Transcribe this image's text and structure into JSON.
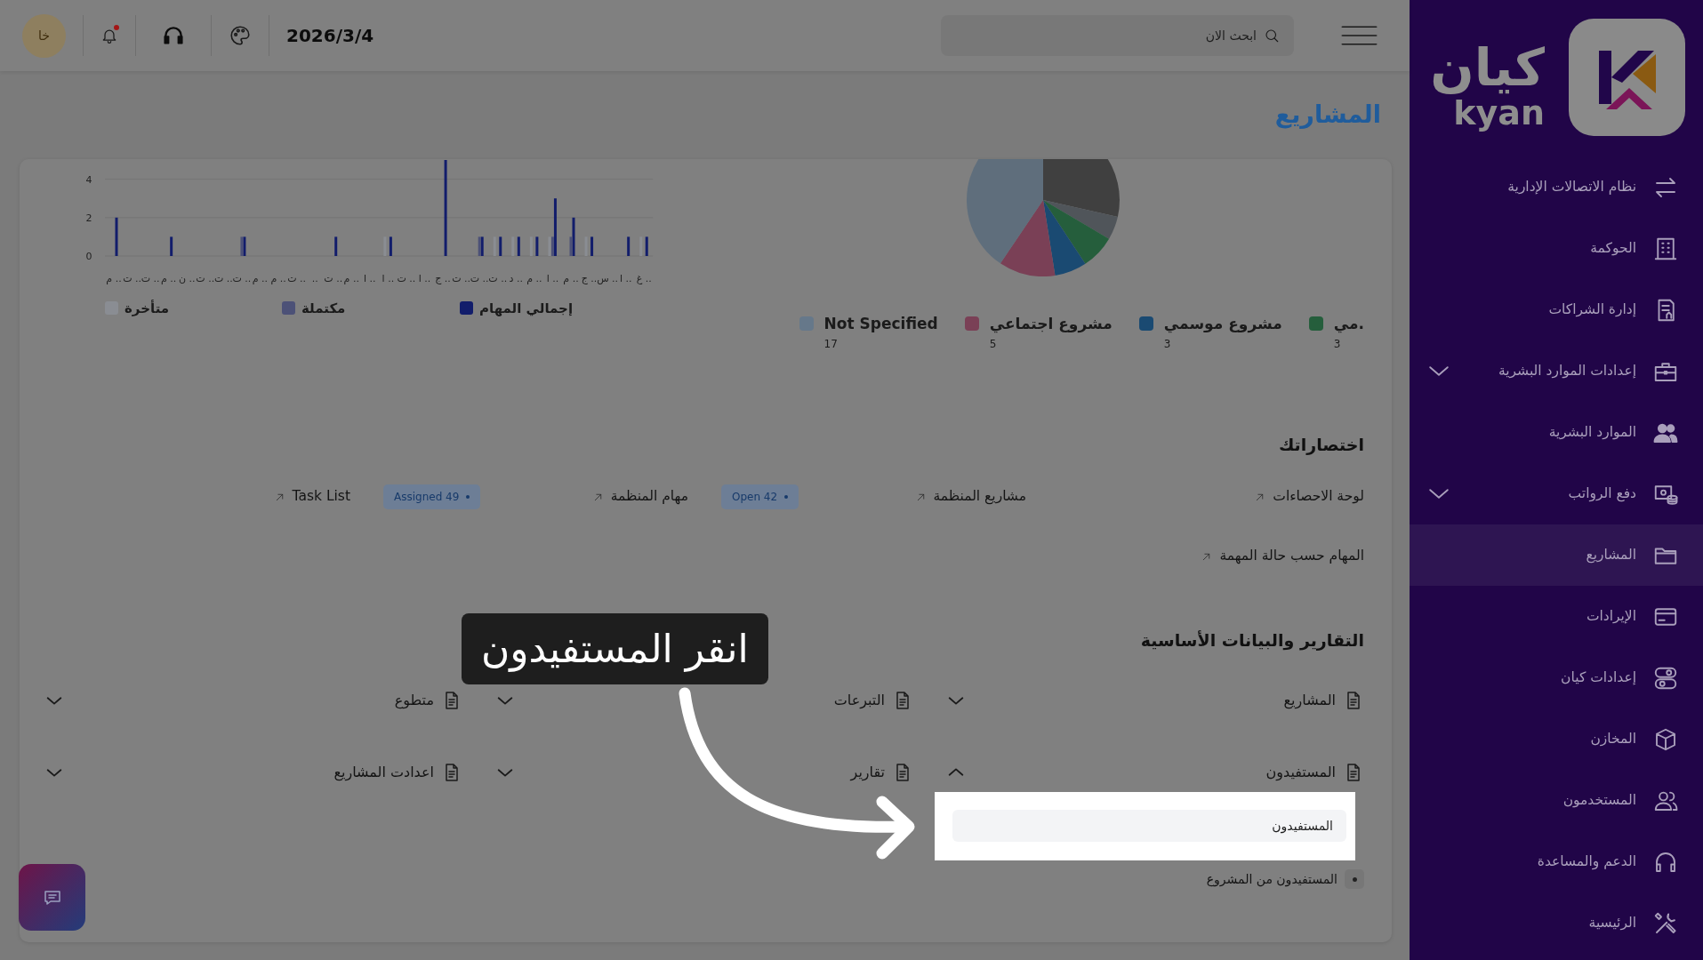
{
  "sidebar": {
    "logo": {
      "arabic": "كيان",
      "latin": "kyan"
    },
    "items": [
      {
        "label": "نظام الاتصالات الإدارية",
        "has_submenu": false,
        "selected": false
      },
      {
        "label": "الحوكمة",
        "has_submenu": false,
        "selected": false
      },
      {
        "label": "إدارة الشراكات",
        "has_submenu": false,
        "selected": false
      },
      {
        "label": "إعدادات الموارد البشرية",
        "has_submenu": true,
        "selected": false
      },
      {
        "label": "الموارد البشرية",
        "has_submenu": false,
        "selected": false
      },
      {
        "label": "دفع الرواتب",
        "has_submenu": true,
        "selected": false
      },
      {
        "label": "المشاريع",
        "has_submenu": false,
        "selected": true
      },
      {
        "label": "الإيرادات",
        "has_submenu": false,
        "selected": false
      },
      {
        "label": "إعدادات كيان",
        "has_submenu": false,
        "selected": false
      },
      {
        "label": "المخازن",
        "has_submenu": false,
        "selected": false
      },
      {
        "label": "المستخدمون",
        "has_submenu": false,
        "selected": false
      },
      {
        "label": "الدعم والمساعدة",
        "has_submenu": false,
        "selected": false
      },
      {
        "label": "الرئيسية",
        "has_submenu": false,
        "selected": false
      }
    ]
  },
  "topbar": {
    "search": {
      "placeholder": "ابحث الان"
    },
    "date": "2026/3/4",
    "unread": true,
    "avatar": "خا"
  },
  "page_title": "المشاريع",
  "pie_legend": [
    {
      "label": "مي.",
      "count": "3",
      "color": "#255e3c"
    },
    {
      "label": "مشروع موسمي",
      "count": "3",
      "color": "#1a4a72"
    },
    {
      "label": "مشروع اجتماعي",
      "count": "5",
      "color": "#7a4056"
    },
    {
      "label": "Not Specified",
      "count": "17",
      "color": "#66788a"
    }
  ],
  "bar_chart": {
    "chart_data": {
      "type": "bar",
      "categories": [
        "م ..",
        "ت ..",
        "ت ..",
        "م ..",
        "ن ..",
        "ت ..",
        "ت ..",
        "ت ..",
        "م ..",
        "م ..",
        "ت ..",
        "..",
        "ت ..",
        "م ..",
        "ا ..",
        "ا ..",
        "ت ..",
        "ا ..",
        "ج ..",
        "ت ..",
        "ت ..",
        "ت ..",
        "د ..",
        "م ..",
        "ا ..",
        "م ..",
        "ج ..",
        "س ..",
        "ا ..",
        "غ .."
      ],
      "yticks": [
        0,
        2,
        4
      ],
      "ylim": [
        0,
        5
      ],
      "legend": "bottom",
      "series": [
        {
          "name": "إجمالي المهام",
          "color": "#121d6b",
          "values": [
            2,
            0,
            0,
            1,
            0,
            0,
            0,
            1,
            0,
            0,
            0,
            0,
            1,
            0,
            0,
            1,
            0,
            0,
            5,
            0,
            1,
            1,
            1,
            1,
            3,
            2,
            1,
            0,
            1,
            1
          ]
        },
        {
          "name": "مكتملة",
          "color": "#4c5177",
          "values": [
            0,
            0,
            0,
            0,
            0,
            0,
            0,
            1,
            0,
            0,
            0,
            0,
            0,
            0,
            0,
            0,
            0,
            0,
            0,
            0,
            1,
            0,
            0,
            0,
            1,
            1,
            0,
            0,
            0,
            0
          ]
        },
        {
          "name": "متأخرة",
          "color": "#8a8d93",
          "values": [
            0,
            0,
            0,
            0,
            0,
            0,
            0,
            0,
            0,
            0,
            0,
            0,
            0,
            0,
            0,
            1,
            0,
            0,
            0,
            0,
            0,
            1,
            1,
            1,
            1,
            0,
            1,
            0,
            0,
            1
          ]
        }
      ]
    }
  },
  "shortcuts": {
    "title": "اختصاراتك",
    "items": [
      {
        "label": "لوحة الاحصاءات"
      },
      {
        "label": "مشاريع المنظمة",
        "badge": "Open 42"
      },
      {
        "label": "مهام المنظمة",
        "badge": "Assigned 49"
      },
      {
        "label": "Task List"
      },
      {
        "label": "المهام حسب حالة المهمة"
      }
    ]
  },
  "reports": {
    "title": "التقارير والبيانات الأساسية",
    "items": [
      {
        "label": "المشاريع",
        "expanded": false
      },
      {
        "label": "التبرعات",
        "expanded": false
      },
      {
        "label": "متطوع",
        "expanded": false
      },
      {
        "label": "المستفيدون",
        "expanded": true,
        "children": [
          {
            "label": "المستفيدون",
            "selected": true
          },
          {
            "label": "المستفيدون من المشروع",
            "selected": false
          }
        ]
      },
      {
        "label": "تقارير",
        "expanded": false
      },
      {
        "label": "اعدادت المشاريع",
        "expanded": false
      }
    ]
  },
  "tutorial": {
    "text": "انقر المستفيدون"
  }
}
